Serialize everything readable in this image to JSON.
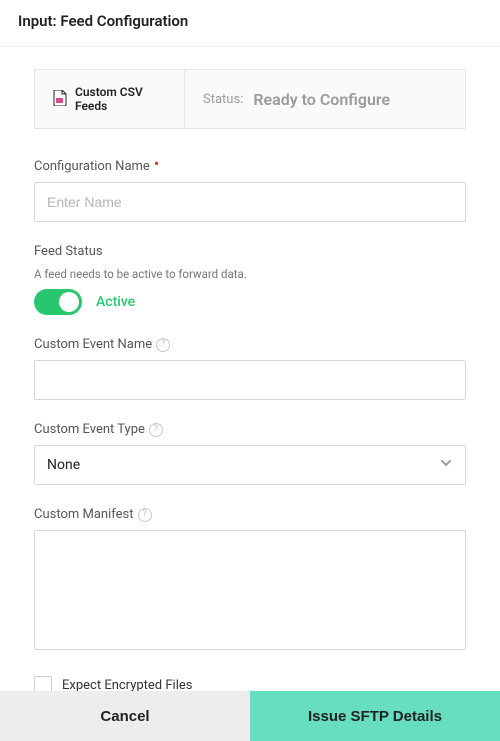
{
  "header": {
    "title": "Input: Feed Configuration"
  },
  "info": {
    "feed_type": "Custom CSV Feeds",
    "status_label": "Status:",
    "status_value": "Ready to Configure"
  },
  "fields": {
    "config_name": {
      "label": "Configuration Name",
      "placeholder": "Enter Name",
      "value": ""
    },
    "feed_status": {
      "label": "Feed Status",
      "subtext": "A feed needs to be active to forward data.",
      "active_label": "Active",
      "value": true
    },
    "custom_event_name": {
      "label": "Custom Event Name",
      "value": ""
    },
    "custom_event_type": {
      "label": "Custom Event Type",
      "selected": "None"
    },
    "custom_manifest": {
      "label": "Custom Manifest",
      "value": ""
    },
    "expect_encrypted": {
      "label": "Expect Encrypted Files",
      "value": false
    }
  },
  "footer": {
    "cancel_label": "Cancel",
    "primary_label": "Issue SFTP Details"
  }
}
